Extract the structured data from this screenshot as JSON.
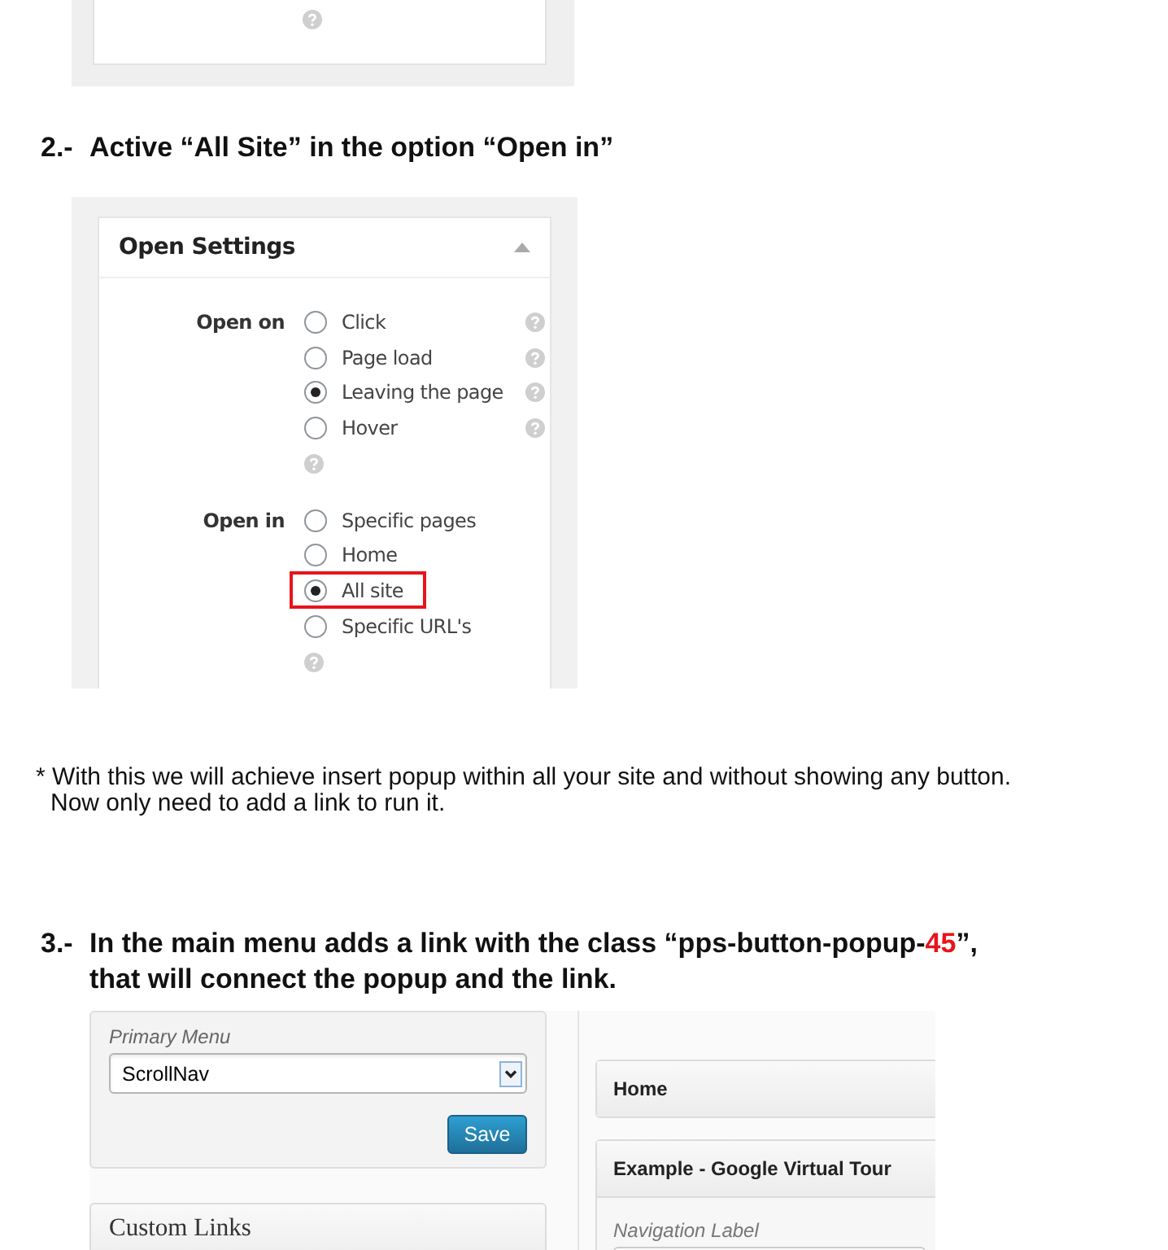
{
  "step2": {
    "number": "2.-",
    "text": "Active “All Site” in the option “Open in”"
  },
  "open_settings": {
    "title": "Open Settings",
    "expanded": true,
    "groups": [
      {
        "label": "Open on",
        "help_below": true,
        "options": [
          {
            "label": "Click",
            "selected": false,
            "help": true,
            "highlighted": false
          },
          {
            "label": "Page load",
            "selected": false,
            "help": true,
            "highlighted": false
          },
          {
            "label": "Leaving the page",
            "selected": true,
            "help": true,
            "highlighted": false
          },
          {
            "label": "Hover",
            "selected": false,
            "help": true,
            "highlighted": false
          }
        ]
      },
      {
        "label": "Open in",
        "help_below": true,
        "options": [
          {
            "label": "Specific pages",
            "selected": false,
            "help": false,
            "highlighted": false
          },
          {
            "label": "Home",
            "selected": false,
            "help": false,
            "highlighted": false
          },
          {
            "label": "All site",
            "selected": true,
            "help": false,
            "highlighted": true
          },
          {
            "label": "Specific URL's",
            "selected": false,
            "help": false,
            "highlighted": false
          }
        ]
      }
    ]
  },
  "note": [
    "* With this we will achieve insert popup within all your site and without showing any button.",
    "Now only need to add a link to run it."
  ],
  "step3": {
    "number": "3.-",
    "lines": [
      [
        {
          "text": "In the main menu adds a link with the class “pps-button-popup-"
        },
        {
          "text": "45",
          "color": "#e8141b"
        },
        {
          "text": "”,"
        }
      ],
      [
        {
          "text": "that will connect the popup and the link."
        }
      ]
    ]
  },
  "menu_editor": {
    "menu_label": "Primary Menu",
    "selected_menu": "ScrollNav",
    "save": "Save",
    "custom_links": "Custom Links",
    "items": [
      {
        "title": "Home",
        "expanded": false
      },
      {
        "title": "Example - Google Virtual Tour",
        "expanded": true,
        "field_label": "Navigation Label"
      }
    ]
  }
}
